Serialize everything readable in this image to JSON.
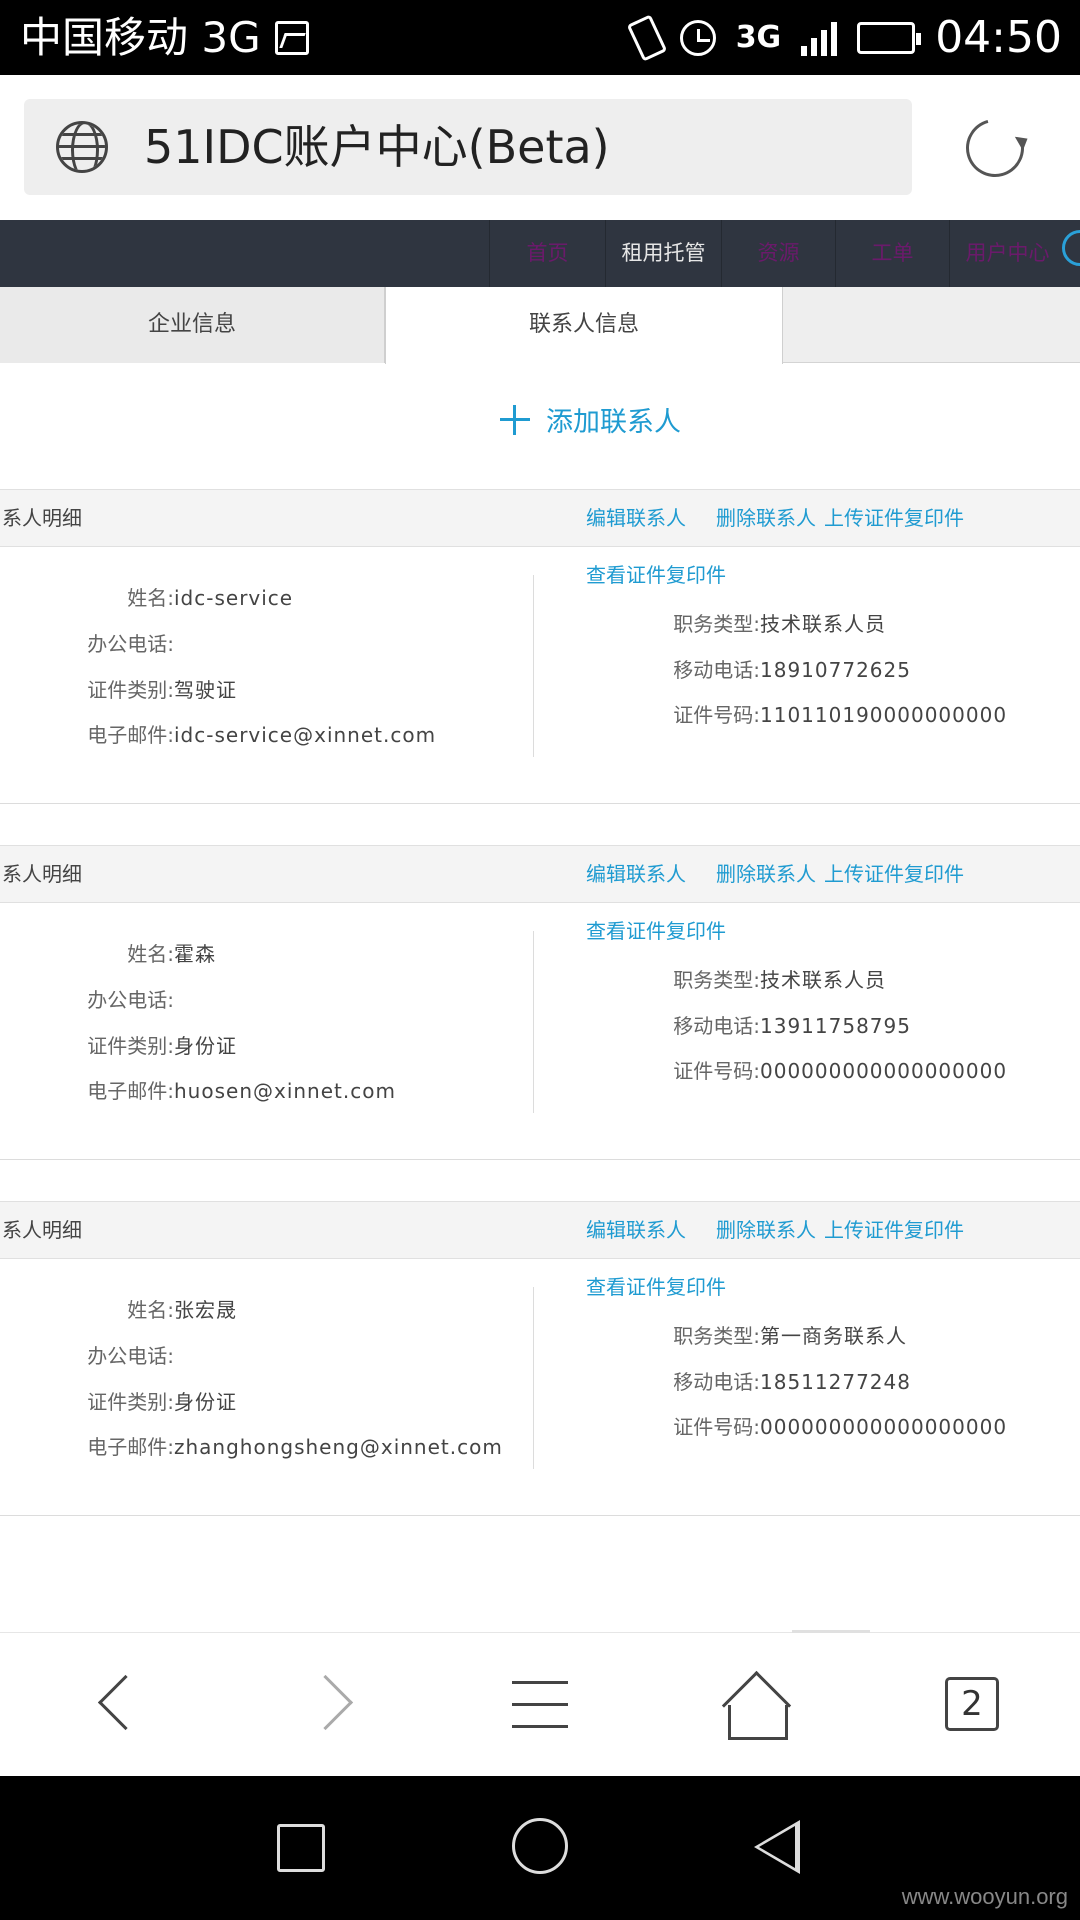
{
  "status_bar": {
    "carrier": "中国移动 3G",
    "network": "3G",
    "time": "04:50",
    "icons": [
      "image-icon",
      "vibrate-icon",
      "alarm-icon",
      "signal-icon",
      "battery-icon"
    ]
  },
  "address_bar": {
    "title": "51IDC账户中心(Beta)"
  },
  "top_nav": {
    "items": [
      "首页",
      "租用托管",
      "资源",
      "工单",
      "用户中心"
    ]
  },
  "tabs": [
    {
      "label": "企业信息",
      "active": false
    },
    {
      "label": "联系人信息",
      "active": true
    }
  ],
  "add_contact_label": "添加联系人",
  "labels": {
    "section_title": "系人明细",
    "edit": "编辑联系人",
    "delete": "删除联系人",
    "upload": "上传证件复印件",
    "view": "查看证件复印件",
    "name": "姓名:",
    "office_phone": "办公电话:",
    "id_type": "证件类别:",
    "email": "电子邮件:",
    "role": "职务类型:",
    "mobile": "移动电话:",
    "id_number": "证件号码:"
  },
  "contacts": [
    {
      "name": "idc-service",
      "office_phone": "",
      "id_type": "驾驶证",
      "email": "idc-service@xinnet.com",
      "role": "技术联系人员",
      "mobile": "18910772625",
      "id_number": "110110190000000000"
    },
    {
      "name": "霍森",
      "office_phone": "",
      "id_type": "身份证",
      "email": "huosen@xinnet.com",
      "role": "技术联系人员",
      "mobile": "13911758795",
      "id_number": "000000000000000000"
    },
    {
      "name": "张宏晟",
      "office_phone": "",
      "id_type": "身份证",
      "email": "zhanghongsheng@xinnet.com",
      "role": "第一商务联系人",
      "mobile": "18511277248",
      "id_number": "000000000000000000"
    }
  ],
  "browser_bar": {
    "tab_count": "2"
  },
  "watermark": "www.wooyun.org",
  "colors": {
    "accent": "#1f9bd1",
    "nav_bg": "#2f3540"
  }
}
